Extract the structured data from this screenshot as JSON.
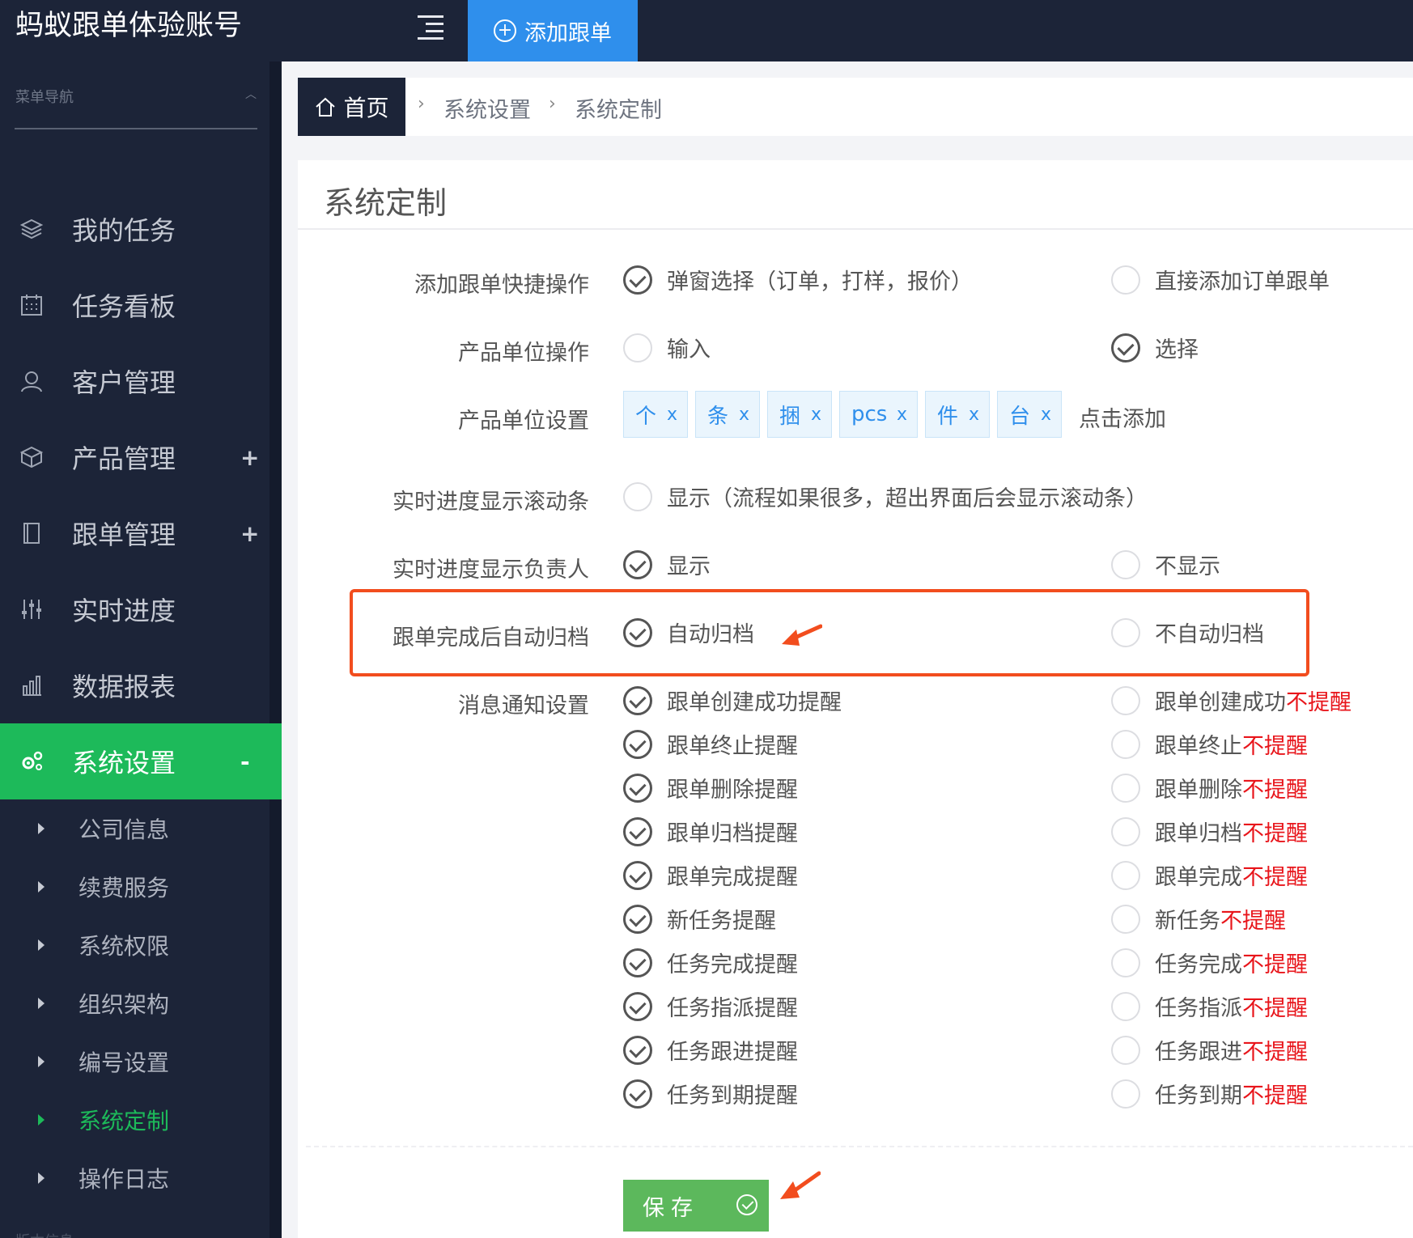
{
  "app": {
    "brand": "蚂蚁跟单体验账号",
    "add_button": "添加跟单"
  },
  "sidebar": {
    "header": "菜单导航",
    "items": [
      {
        "label": "我的任务",
        "icon": "layers-icon",
        "expander": ""
      },
      {
        "label": "任务看板",
        "icon": "calendar-icon",
        "expander": ""
      },
      {
        "label": "客户管理",
        "icon": "user-icon",
        "expander": ""
      },
      {
        "label": "产品管理",
        "icon": "box-icon",
        "expander": "+"
      },
      {
        "label": "跟单管理",
        "icon": "book-icon",
        "expander": "+"
      },
      {
        "label": "实时进度",
        "icon": "sliders-icon",
        "expander": ""
      },
      {
        "label": "数据报表",
        "icon": "bar-chart-icon",
        "expander": ""
      },
      {
        "label": "系统设置",
        "icon": "gear-icon",
        "expander": "-",
        "active": true
      }
    ],
    "subitems": [
      {
        "label": "公司信息"
      },
      {
        "label": "续费服务"
      },
      {
        "label": "系统权限"
      },
      {
        "label": "组织架构"
      },
      {
        "label": "编号设置"
      },
      {
        "label": "系统定制",
        "active": true
      },
      {
        "label": "操作日志"
      }
    ],
    "footer": "版本信息"
  },
  "breadcrumb": {
    "home": "首页",
    "level1": "系统设置",
    "level2": "系统定制"
  },
  "panel": {
    "title": "系统定制",
    "rows": {
      "quick_add": {
        "label": "添加跟单快捷操作",
        "opt1": "弹窗选择（订单，打样，报价）",
        "opt2": "直接添加订单跟单",
        "selected": 1
      },
      "unit_op": {
        "label": "产品单位操作",
        "opt1": "输入",
        "opt2": "选择",
        "selected": 2
      },
      "unit_set": {
        "label": "产品单位设置",
        "tags": [
          "个",
          "条",
          "捆",
          "pcs",
          "件",
          "台"
        ],
        "tag_remove": "x",
        "add": "点击添加"
      },
      "scroll": {
        "label": "实时进度显示滚动条",
        "opt1": "显示（流程如果很多，超出界面后会显示滚动条）",
        "selected": 0
      },
      "owner": {
        "label": "实时进度显示负责人",
        "opt1": "显示",
        "opt2": "不显示",
        "selected": 1
      },
      "archive": {
        "label": "跟单完成后自动归档",
        "opt1": "自动归档",
        "opt2": "不自动归档",
        "selected": 1
      },
      "notify": {
        "label": "消息通知设置",
        "suffix_off": "不提醒",
        "items": [
          {
            "on": "跟单创建成功提醒",
            "off_prefix": "跟单创建成功"
          },
          {
            "on": "跟单终止提醒",
            "off_prefix": "跟单终止"
          },
          {
            "on": "跟单删除提醒",
            "off_prefix": "跟单删除"
          },
          {
            "on": "跟单归档提醒",
            "off_prefix": "跟单归档"
          },
          {
            "on": "跟单完成提醒",
            "off_prefix": "跟单完成"
          },
          {
            "on": "新任务提醒",
            "off_prefix": "新任务"
          },
          {
            "on": "任务完成提醒",
            "off_prefix": "任务完成"
          },
          {
            "on": "任务指派提醒",
            "off_prefix": "任务指派"
          },
          {
            "on": "任务跟进提醒",
            "off_prefix": "任务跟进"
          },
          {
            "on": "任务到期提醒",
            "off_prefix": "任务到期"
          }
        ]
      }
    },
    "save_label": "保存"
  },
  "colors": {
    "sidebar_bg": "#1c2438",
    "active_green": "#1dba5a",
    "accent_blue": "#2f8fec",
    "alert_red": "#e8151b",
    "highlight_orange": "#f24d1e",
    "save_green": "#5cb85c"
  }
}
